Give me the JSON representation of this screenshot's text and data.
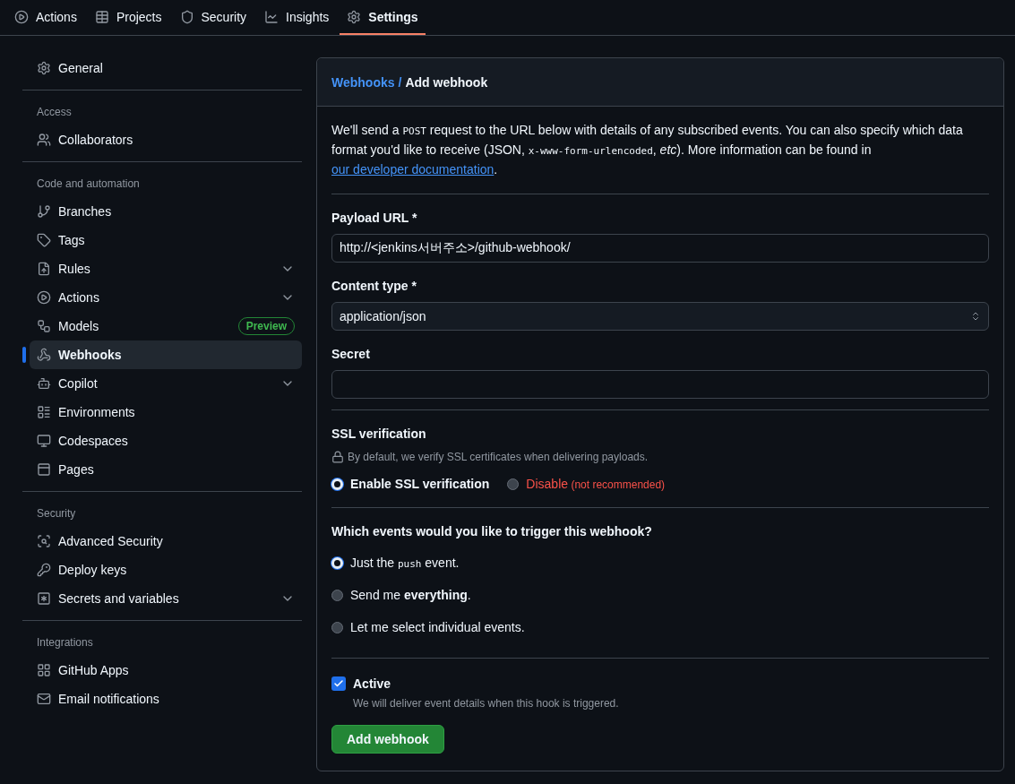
{
  "nav_tabs": [
    {
      "label": "Actions",
      "selected": false
    },
    {
      "label": "Projects",
      "selected": false
    },
    {
      "label": "Security",
      "selected": false
    },
    {
      "label": "Insights",
      "selected": false
    },
    {
      "label": "Settings",
      "selected": true
    }
  ],
  "sidebar": {
    "sections": [
      {
        "items": [
          {
            "label": "General",
            "selected": false
          }
        ]
      },
      {
        "heading": "Access",
        "items": [
          {
            "label": "Collaborators",
            "selected": false
          }
        ]
      },
      {
        "heading": "Code and automation",
        "items": [
          {
            "label": "Branches",
            "selected": false
          },
          {
            "label": "Tags",
            "selected": false
          },
          {
            "label": "Rules",
            "selected": false,
            "expanded": false
          },
          {
            "label": "Actions",
            "selected": false,
            "expanded": false
          },
          {
            "label": "Models",
            "selected": false,
            "badge": "Preview"
          },
          {
            "label": "Webhooks",
            "selected": true
          },
          {
            "label": "Copilot",
            "selected": false,
            "expanded": false
          },
          {
            "label": "Environments",
            "selected": false
          },
          {
            "label": "Codespaces",
            "selected": false
          },
          {
            "label": "Pages",
            "selected": false
          }
        ]
      },
      {
        "heading": "Security",
        "items": [
          {
            "label": "Advanced Security",
            "selected": false
          },
          {
            "label": "Deploy keys",
            "selected": false
          },
          {
            "label": "Secrets and variables",
            "selected": false,
            "expanded": false
          }
        ]
      },
      {
        "heading": "Integrations",
        "items": [
          {
            "label": "GitHub Apps",
            "selected": false
          },
          {
            "label": "Email notifications",
            "selected": false
          }
        ]
      }
    ]
  },
  "breadcrumb": {
    "parent": "Webhooks",
    "separator": "/",
    "current": "Add webhook"
  },
  "description": [
    {
      "kind": "text",
      "text": "We'll send a "
    },
    {
      "kind": "code",
      "text": "POST"
    },
    {
      "kind": "text",
      "text": " request to the URL below with details of any subscribed events. You can also specify which data format you'd like to receive (JSON, "
    },
    {
      "kind": "code",
      "text": "x-www-form-urlencoded"
    },
    {
      "kind": "text",
      "text": ", *etc*). More information can be found in "
    },
    {
      "kind": "link",
      "text": "our developer documentation"
    },
    {
      "kind": "text",
      "text": "."
    }
  ],
  "payload_url": {
    "label": "Payload URL *",
    "value": "http://<jenkins서버주소>/github-webhook/"
  },
  "content_type": {
    "label": "Content type *",
    "value": "application/json"
  },
  "secret": {
    "label": "Secret"
  },
  "ssl": {
    "heading": "SSL verification",
    "hint": "By default, we verify SSL certificates when delivering payloads.",
    "options": [
      {
        "kind": "normal",
        "label": "Enable SSL verification",
        "selected": true
      },
      {
        "kind": "danger",
        "label": "Disable",
        "note": "(not recommended)",
        "selected": false
      }
    ]
  },
  "events": {
    "question": "Which events would you like to trigger this webhook?",
    "options": [
      {
        "selected": true,
        "parts": [
          {
            "kind": "text",
            "text": "Just the "
          },
          {
            "kind": "code",
            "text": "push"
          },
          {
            "kind": "text",
            "text": " event."
          }
        ]
      },
      {
        "selected": false,
        "parts": [
          {
            "kind": "text",
            "text": "Send me **everything**."
          }
        ]
      },
      {
        "selected": false,
        "parts": [
          {
            "kind": "text",
            "text": "Let me select individual events."
          }
        ]
      }
    ]
  },
  "active": {
    "label": "Active",
    "checked": true,
    "hint": "We will deliver event details when this hook is triggered."
  },
  "submit": "Add webhook"
}
